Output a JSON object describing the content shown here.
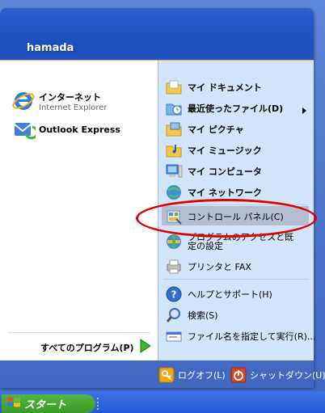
{
  "user": {
    "name": "hamada"
  },
  "left": {
    "pinned": [
      {
        "title": "インターネット",
        "subtitle": "Internet Explorer",
        "icon": "internet-explorer-icon"
      },
      {
        "title": "Outlook Express",
        "icon": "outlook-express-icon"
      }
    ],
    "all_programs_label": "すべてのプログラム(P)"
  },
  "right": {
    "items": [
      {
        "label": "マイ ドキュメント",
        "icon": "my-documents-folder-icon"
      },
      {
        "label": "最近使ったファイル(D)",
        "icon": "recent-files-icon"
      },
      {
        "label": "マイ ピクチャ",
        "icon": "my-pictures-folder-icon"
      },
      {
        "label": "マイ ミュージック",
        "icon": "my-music-folder-icon"
      },
      {
        "label": "マイ コンピュータ",
        "icon": "my-computer-icon"
      },
      {
        "label": "マイ ネットワーク",
        "icon": "my-network-icon"
      },
      {
        "label": "コントロール パネル(C)",
        "icon": "control-panel-icon"
      },
      {
        "label": "プログラムのアクセスと既定の設定",
        "icon": "program-access-icon"
      },
      {
        "label": "プリンタと FAX",
        "icon": "printer-fax-icon"
      },
      {
        "label": "ヘルプとサポート(H)",
        "icon": "help-icon"
      },
      {
        "label": "検索(S)",
        "icon": "search-icon"
      },
      {
        "label": "ファイル名を指定して実行(R)...",
        "icon": "run-icon"
      }
    ]
  },
  "footer": {
    "logoff_label": "ログオフ(L)",
    "shutdown_label": "シャットダウン(U)"
  },
  "taskbar": {
    "start_label": "スタート"
  }
}
